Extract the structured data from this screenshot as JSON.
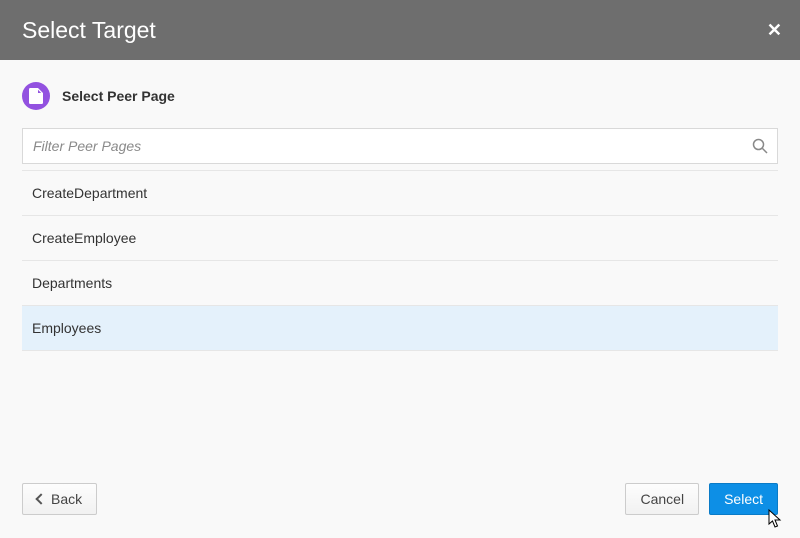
{
  "header": {
    "title": "Select Target"
  },
  "section": {
    "title": "Select Peer Page"
  },
  "filter": {
    "placeholder": "Filter Peer Pages"
  },
  "items": [
    {
      "label": "CreateDepartment",
      "selected": false
    },
    {
      "label": "CreateEmployee",
      "selected": false
    },
    {
      "label": "Departments",
      "selected": false
    },
    {
      "label": "Employees",
      "selected": true
    }
  ],
  "footer": {
    "back": "Back",
    "cancel": "Cancel",
    "select": "Select"
  }
}
